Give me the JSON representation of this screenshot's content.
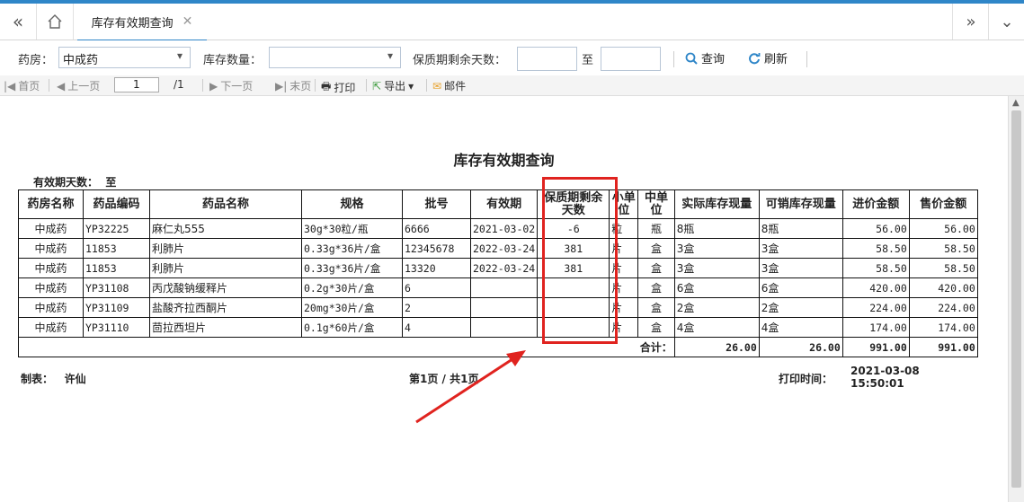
{
  "tabs": {
    "active_title": "库存有效期查询"
  },
  "filters": {
    "pharmacy_label": "药房：",
    "pharmacy_value": "中成药",
    "stock_qty_label": "库存数量：",
    "stock_qty_value": "",
    "shelf_days_label": "保质期剩余天数：",
    "to_label": "至",
    "query_label": "查询",
    "refresh_label": "刷新"
  },
  "toolbar": {
    "first": "首页",
    "prev": "上一页",
    "page_value": "1",
    "page_total": "/1",
    "next": "下一页",
    "last": "末页",
    "print": "打印",
    "export": "导出",
    "mail": "邮件"
  },
  "report": {
    "title": "库存有效期查询",
    "days_label": "有效期天数：",
    "days_to": "至",
    "headers": {
      "pharmacy": "药房名称",
      "code": "药品编码",
      "name": "药品名称",
      "spec": "规格",
      "batch": "批号",
      "expiry": "有效期",
      "remain_days_1": "保质期剩余",
      "remain_days_2": "天数",
      "small_unit_1": "小单",
      "small_unit_2": "位",
      "mid_unit_1": "中单",
      "mid_unit_2": "位",
      "actual_stock": "实际库存现量",
      "sellable_stock": "可销库存现量",
      "purchase_amount": "进价金额",
      "sale_amount": "售价金额"
    },
    "rows": [
      {
        "pharmacy": "中成药",
        "code": "YP32225",
        "name": "麻仁丸555",
        "spec": "30g*30粒/瓶",
        "batch": "6666",
        "expiry": "2021-03-02",
        "remain": "-6",
        "small": "粒",
        "mid": "瓶",
        "actual": "8瓶",
        "sellable": "8瓶",
        "purchase": "56.00",
        "sale": "56.00"
      },
      {
        "pharmacy": "中成药",
        "code": "11853",
        "name": "利肺片",
        "spec": "0.33g*36片/盒",
        "batch": "12345678",
        "expiry": "2022-03-24",
        "remain": "381",
        "small": "片",
        "mid": "盒",
        "actual": "3盒",
        "sellable": "3盒",
        "purchase": "58.50",
        "sale": "58.50"
      },
      {
        "pharmacy": "中成药",
        "code": "11853",
        "name": "利肺片",
        "spec": "0.33g*36片/盒",
        "batch": "13320",
        "expiry": "2022-03-24",
        "remain": "381",
        "small": "片",
        "mid": "盒",
        "actual": "3盒",
        "sellable": "3盒",
        "purchase": "58.50",
        "sale": "58.50"
      },
      {
        "pharmacy": "中成药",
        "code": "YP31108",
        "name": "丙戊酸钠缓释片",
        "spec": "0.2g*30片/盒",
        "batch": "6",
        "expiry": "",
        "remain": "",
        "small": "片",
        "mid": "盒",
        "actual": "6盒",
        "sellable": "6盒",
        "purchase": "420.00",
        "sale": "420.00"
      },
      {
        "pharmacy": "中成药",
        "code": "YP31109",
        "name": "盐酸齐拉西酮片",
        "spec": "20mg*30片/盒",
        "batch": "2",
        "expiry": "",
        "remain": "",
        "small": "片",
        "mid": "盒",
        "actual": "2盒",
        "sellable": "2盒",
        "purchase": "224.00",
        "sale": "224.00"
      },
      {
        "pharmacy": "中成药",
        "code": "YP31110",
        "name": "茴拉西坦片",
        "spec": "0.1g*60片/盒",
        "batch": "4",
        "expiry": "",
        "remain": "",
        "small": "片",
        "mid": "盒",
        "actual": "4盒",
        "sellable": "4盒",
        "purchase": "174.00",
        "sale": "174.00"
      }
    ],
    "total_label": "合计：",
    "total_actual": "26.00",
    "total_sellable": "26.00",
    "total_purchase": "991.00",
    "total_sale": "991.00",
    "maker_label": "制表：",
    "maker_name": "许仙",
    "page_info": "第1页 / 共1页",
    "print_time_label": "打印时间：",
    "print_date": "2021-03-08",
    "print_time": "15:50:01"
  },
  "colors": {
    "accent": "#2f86c8",
    "highlight": "#e0231f"
  }
}
